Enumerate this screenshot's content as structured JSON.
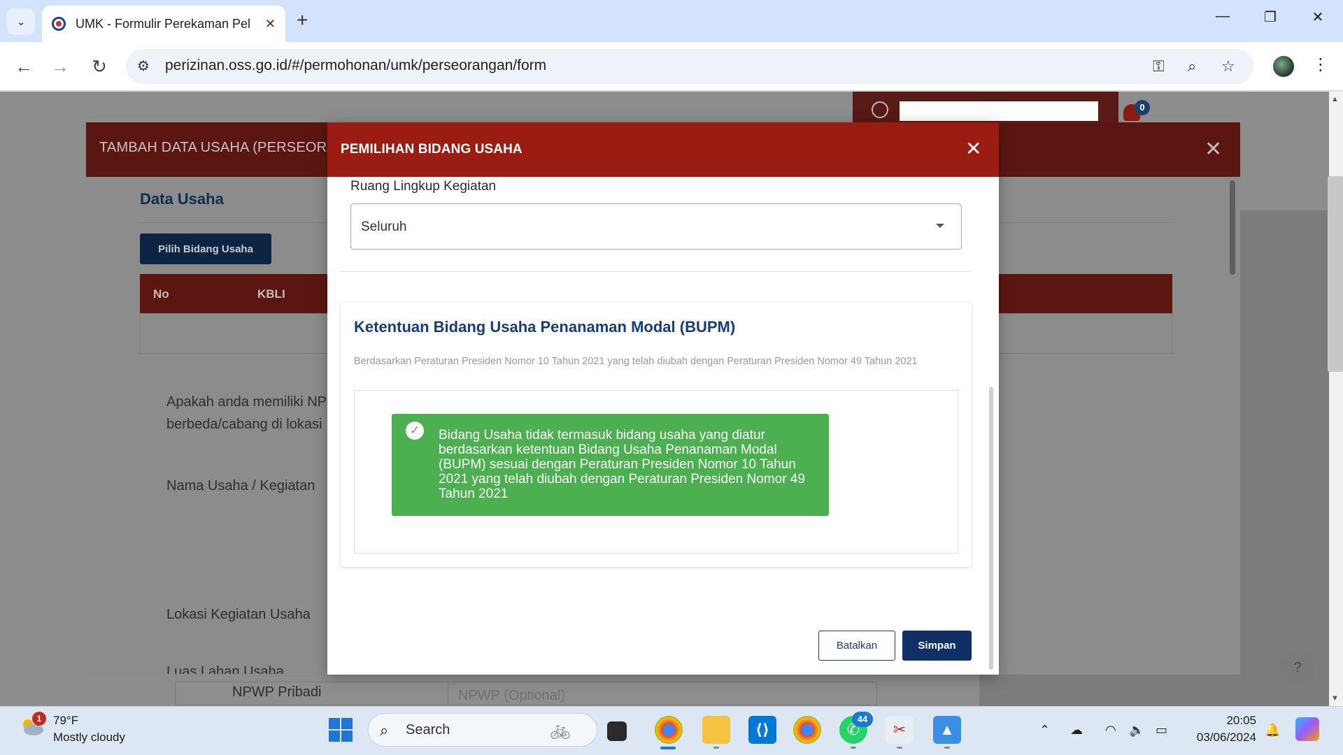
{
  "browser": {
    "tab_title": "UMK - Formulir Perekaman Pelaku Usaha",
    "tab_close": "✕",
    "new_tab": "+",
    "url": "perizinan.oss.go.id/#/permohonan/umk/perseorangan/form",
    "window_controls": {
      "minimize": "—",
      "restore": "❐",
      "close": "✕"
    }
  },
  "page": {
    "notification_count": "0",
    "background_modal": {
      "title": "TAMBAH DATA USAHA (PERSEORANGAN)",
      "section_title": "Data Usaha",
      "pilih_button": "Pilih Bidang Usaha",
      "table_headers": [
        "No",
        "KBLI"
      ],
      "question_line1": "Apakah anda memiliki NP",
      "question_line2": "berbeda/cabang di lokasi",
      "nama_usaha_label": "Nama Usaha / Kegiatan",
      "lokasi_label": "Lokasi Kegiatan Usaha",
      "luas_label": "Luas Lahan Usaha",
      "npwp_label": "NPWP Pribadi",
      "npwp_placeholder": "NPWP (Optional)"
    }
  },
  "modal": {
    "title": "PEMILIHAN BIDANG USAHA",
    "field_label": "Ruang Lingkup Kegiatan",
    "select_value": "Seluruh",
    "card_title": "Ketentuan Bidang Usaha Penanaman Modal (BUPM)",
    "card_description": "Berdasarkan Peraturan Presiden Nomor 10 Tahun 2021 yang telah diubah dengan Peraturan Presiden Nomor 49 Tahun 2021",
    "alert_text": "Bidang Usaha tidak termasuk bidang usaha yang diatur berdasarkan ketentuan Bidang Usaha Penanaman Modal (BUPM) sesuai dengan Peraturan Presiden Nomor 10 Tahun 2021 yang telah diubah dengan Peraturan Presiden Nomor 49 Tahun 2021",
    "cancel_button": "Batalkan",
    "save_button": "Simpan"
  },
  "taskbar": {
    "weather_temp": "79°F",
    "weather_desc": "Mostly cloudy",
    "weather_badge": "1",
    "search_text": "Search",
    "whatsapp_badge": "44",
    "time": "20:05",
    "date": "03/06/2024"
  },
  "colors": {
    "modal_header": "#9b1c13",
    "primary_blue": "#0f2f66",
    "success_green": "#4caf50"
  }
}
